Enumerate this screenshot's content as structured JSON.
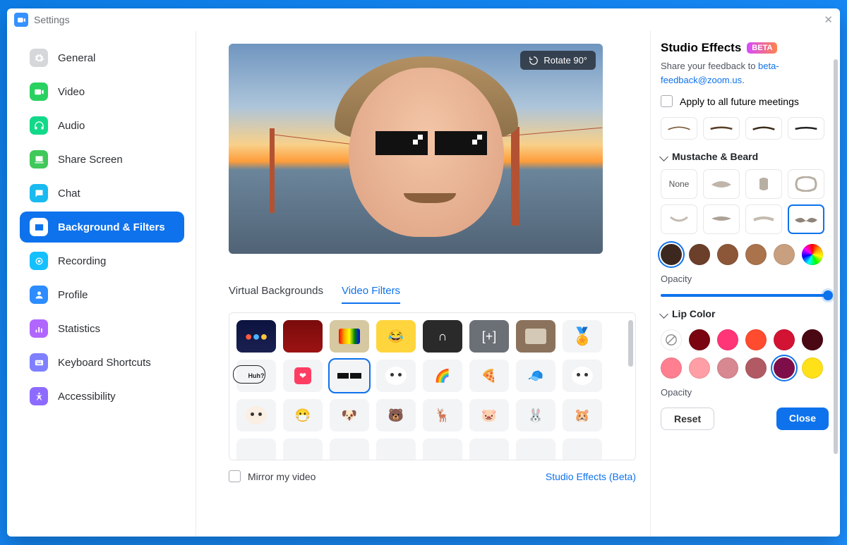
{
  "window": {
    "title": "Settings"
  },
  "sidebar": {
    "items": [
      {
        "label": "General"
      },
      {
        "label": "Video"
      },
      {
        "label": "Audio"
      },
      {
        "label": "Share Screen"
      },
      {
        "label": "Chat"
      },
      {
        "label": "Background & Filters"
      },
      {
        "label": "Recording"
      },
      {
        "label": "Profile"
      },
      {
        "label": "Statistics"
      },
      {
        "label": "Keyboard Shortcuts"
      },
      {
        "label": "Accessibility"
      }
    ],
    "activeIndex": 5
  },
  "preview": {
    "rotateLabel": "Rotate 90°"
  },
  "tabs": {
    "bg": "Virtual Backgrounds",
    "filters": "Video Filters",
    "activeIndex": 1
  },
  "filters": {
    "row1": [
      "lights",
      "curtain",
      "tv",
      "emoji",
      "arch",
      "bracket",
      "oldtv",
      "medal"
    ],
    "row2": [
      "huh",
      "like",
      "deal-glasses",
      "sprout",
      "rainbow",
      "pizza",
      "cap",
      "blush"
    ],
    "row3": [
      "mask",
      "surgical",
      "puppy1",
      "puppy2",
      "reindeer",
      "pig",
      "bunny",
      "hamster"
    ],
    "selected": "deal-glasses"
  },
  "footer": {
    "mirror": "Mirror my video",
    "studioLink": "Studio Effects (Beta)"
  },
  "studio": {
    "title": "Studio Effects",
    "beta": "BETA",
    "feedbackPrefix": "Share your feedback to ",
    "feedbackEmail": "beta-feedback@zoom.us",
    "applyAll": "Apply to all future meetings",
    "sections": {
      "mustache": {
        "title": "Mustache & Beard",
        "noneLabel": "None"
      },
      "lip": {
        "title": "Lip Color"
      }
    },
    "swatchesMustache": [
      "#3d281f",
      "#6b3f2a",
      "#8c5738",
      "#aa734c",
      "#c8a07f",
      "rainbow"
    ],
    "swatchesLip": [
      "none",
      "#7a0510",
      "#ff3578",
      "#ff4b2e",
      "#d31334",
      "#4a0812",
      "#ff7f90",
      "#ff9ea4",
      "#d88891",
      "#b25a64",
      "#7d0e49",
      "#ffe11a"
    ],
    "lipSelected": 10,
    "opacity": "Opacity",
    "reset": "Reset",
    "close": "Close"
  }
}
